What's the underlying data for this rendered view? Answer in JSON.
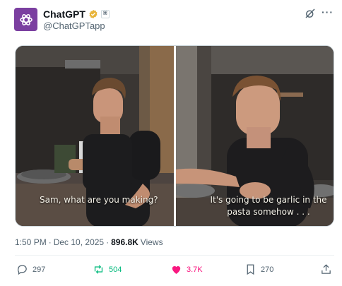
{
  "author": {
    "display_name": "ChatGPT",
    "handle": "@ChatGPTapp",
    "affiliate_badge": "⌘"
  },
  "media": {
    "left_caption": "Sam, what are you making?",
    "right_caption": "It's going to be garlic in the pasta somehow . . ."
  },
  "meta": {
    "time": "1:50 PM",
    "dot": "·",
    "date": "Dec 10, 2025",
    "dot2": "·",
    "views_count": "896.8K",
    "views_label": "Views"
  },
  "actions": {
    "replies": "297",
    "reposts": "504",
    "likes": "3.7K",
    "bookmarks": "270"
  },
  "colors": {
    "avatar_bg": "#7b3fa0",
    "verified": "#e8b43a",
    "repost_active": "#00ba7c",
    "like_active": "#f91880",
    "muted": "#536471"
  }
}
